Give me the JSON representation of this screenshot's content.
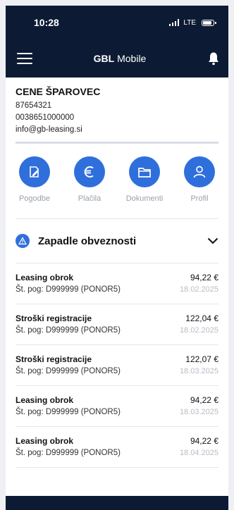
{
  "status": {
    "time": "10:28",
    "network": "LTE"
  },
  "nav": {
    "brand": "GBL",
    "title": "Mobile"
  },
  "user": {
    "name": "CENE ŠPAROVEC",
    "id": "87654321",
    "phone": "0038651000000",
    "email": "info@gb-leasing.si"
  },
  "quick_actions": [
    {
      "label": "Pogodbe",
      "icon": "contract-edit-icon"
    },
    {
      "label": "Plačila",
      "icon": "euro-icon"
    },
    {
      "label": "Dokumenti",
      "icon": "folder-icon"
    },
    {
      "label": "Profil",
      "icon": "user-icon"
    }
  ],
  "section": {
    "title": "Zapadle obveznosti"
  },
  "obligations": [
    {
      "title": "Leasing obrok",
      "contract": "Št. pog: D999999 (PONOR5)",
      "amount": "94,22 €",
      "date": "18.02.2025"
    },
    {
      "title": "Stroški registracije",
      "contract": "Št. pog: D999999 (PONOR5)",
      "amount": "122,04 €",
      "date": "18.02.2025"
    },
    {
      "title": "Stroški registracije",
      "contract": "Št. pog: D999999 (PONOR5)",
      "amount": "122,07 €",
      "date": "18.03.2025"
    },
    {
      "title": "Leasing obrok",
      "contract": "Št. pog: D999999 (PONOR5)",
      "amount": "94,22 €",
      "date": "18.03.2025"
    },
    {
      "title": "Leasing obrok",
      "contract": "Št. pog: D999999 (PONOR5)",
      "amount": "94,22 €",
      "date": "18.04.2025"
    }
  ],
  "colors": {
    "navy": "#0d1a33",
    "accent": "#2f6fdc",
    "muted": "#9aa0a8"
  }
}
